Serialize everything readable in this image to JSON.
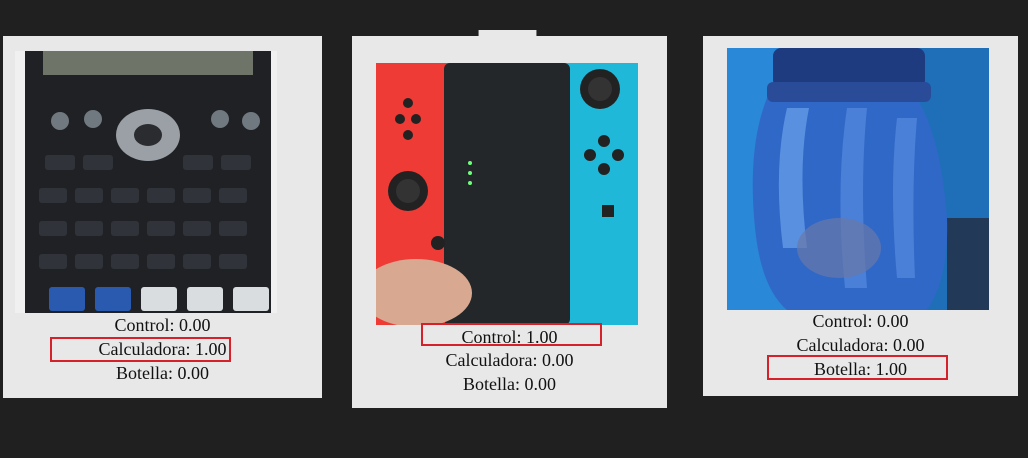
{
  "cards": [
    {
      "object": "calculator",
      "predictions": [
        {
          "label": "Control: 0.00",
          "highlighted": false
        },
        {
          "label": "Calculadora: 1.00",
          "highlighted": true
        },
        {
          "label": "Botella: 0.00",
          "highlighted": false
        }
      ]
    },
    {
      "object": "game-controller",
      "predictions": [
        {
          "label": "Control: 1.00",
          "highlighted": true
        },
        {
          "label": "Calculadora: 0.00",
          "highlighted": false
        },
        {
          "label": "Botella: 0.00",
          "highlighted": false
        }
      ]
    },
    {
      "object": "bottle",
      "predictions": [
        {
          "label": "Control: 0.00",
          "highlighted": false
        },
        {
          "label": "Calculadora: 0.00",
          "highlighted": false
        },
        {
          "label": "Botella: 1.00",
          "highlighted": true
        }
      ]
    }
  ],
  "colors": {
    "background": "#202020",
    "card": "#e8e8e8",
    "highlight_border": "#d6202a"
  }
}
